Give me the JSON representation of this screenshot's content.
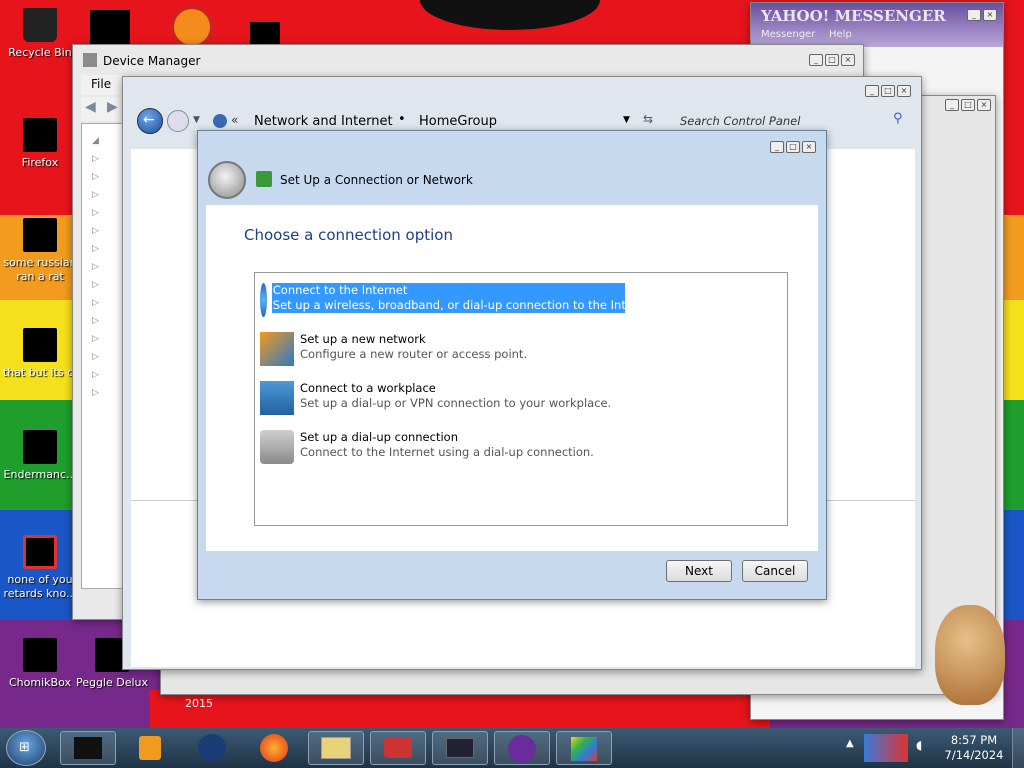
{
  "desktop": {
    "icons": [
      {
        "label": "Recycle Bin",
        "x": 0
      },
      {
        "label": "Firefox"
      },
      {
        "label": "some russian ran a rat"
      },
      {
        "label": "that but its c"
      },
      {
        "label": "Endermanc..."
      },
      {
        "label": "none of you retards kno..."
      },
      {
        "label": "ChomikBox"
      },
      {
        "label": "Peggle Delux"
      }
    ],
    "year_text": "2015"
  },
  "yahoo": {
    "title": "YAHOO! MESSENGER",
    "menu": [
      "Messenger",
      "Help"
    ]
  },
  "device_manager": {
    "title": "Device Manager",
    "menu_file": "File"
  },
  "control_panel": {
    "breadcrumb": [
      "Network and Internet",
      "HomeGroup"
    ],
    "search_placeholder": "Search Control Panel"
  },
  "wizard": {
    "title": "Set Up a Connection or Network",
    "heading": "Choose a connection option",
    "options": [
      {
        "title": "Connect to the Internet",
        "desc": "Set up a wireless, broadband, or dial-up connection to the Internet.",
        "selected": true
      },
      {
        "title": "Set up a new network",
        "desc": "Configure a new router or access point."
      },
      {
        "title": "Connect to a workplace",
        "desc": "Set up a dial-up or VPN connection to your workplace."
      },
      {
        "title": "Set up a dial-up connection",
        "desc": "Connect to the Internet using a dial-up connection."
      }
    ],
    "next": "Next",
    "cancel": "Cancel"
  },
  "taskbar": {
    "time": "8:57 PM",
    "date": "7/14/2024"
  },
  "colors": {
    "selection": "#3399ff",
    "header": "#c8d9ec",
    "heading": "#1e3e8c"
  }
}
